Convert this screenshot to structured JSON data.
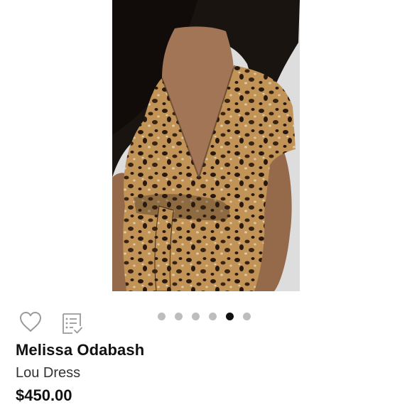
{
  "listing": {
    "brand": "Melissa Odabash",
    "item_name": "Lou Dress",
    "price": "$450.00"
  },
  "gallery": {
    "photo_count": 6,
    "active_photo_index": 4,
    "dots": [
      {
        "active": false
      },
      {
        "active": false
      },
      {
        "active": false
      },
      {
        "active": false
      },
      {
        "active": true
      },
      {
        "active": false
      }
    ]
  },
  "actions": {
    "like_icon": "heart-outline-icon",
    "notes_icon": "checklist-notes-icon"
  },
  "colors": {
    "dot_inactive": "#bdbdbd",
    "dot_active": "#111111",
    "icon_stroke": "#9a9a9a",
    "text_primary": "#111111"
  }
}
